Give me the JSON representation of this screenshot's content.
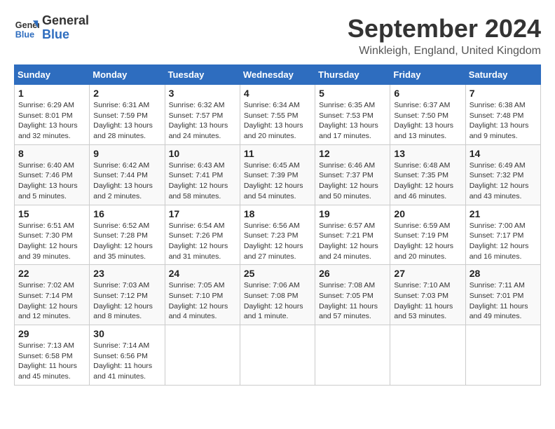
{
  "logo": {
    "line1": "General",
    "line2": "Blue"
  },
  "title": "September 2024",
  "subtitle": "Winkleigh, England, United Kingdom",
  "calendar": {
    "headers": [
      "Sunday",
      "Monday",
      "Tuesday",
      "Wednesday",
      "Thursday",
      "Friday",
      "Saturday"
    ],
    "weeks": [
      [
        {
          "day": "",
          "info": ""
        },
        {
          "day": "2",
          "info": "Sunrise: 6:31 AM\nSunset: 7:59 PM\nDaylight: 13 hours\nand 28 minutes."
        },
        {
          "day": "3",
          "info": "Sunrise: 6:32 AM\nSunset: 7:57 PM\nDaylight: 13 hours\nand 24 minutes."
        },
        {
          "day": "4",
          "info": "Sunrise: 6:34 AM\nSunset: 7:55 PM\nDaylight: 13 hours\nand 20 minutes."
        },
        {
          "day": "5",
          "info": "Sunrise: 6:35 AM\nSunset: 7:53 PM\nDaylight: 13 hours\nand 17 minutes."
        },
        {
          "day": "6",
          "info": "Sunrise: 6:37 AM\nSunset: 7:50 PM\nDaylight: 13 hours\nand 13 minutes."
        },
        {
          "day": "7",
          "info": "Sunrise: 6:38 AM\nSunset: 7:48 PM\nDaylight: 13 hours\nand 9 minutes."
        }
      ],
      [
        {
          "day": "8",
          "info": "Sunrise: 6:40 AM\nSunset: 7:46 PM\nDaylight: 13 hours\nand 5 minutes."
        },
        {
          "day": "9",
          "info": "Sunrise: 6:42 AM\nSunset: 7:44 PM\nDaylight: 13 hours\nand 2 minutes."
        },
        {
          "day": "10",
          "info": "Sunrise: 6:43 AM\nSunset: 7:41 PM\nDaylight: 12 hours\nand 58 minutes."
        },
        {
          "day": "11",
          "info": "Sunrise: 6:45 AM\nSunset: 7:39 PM\nDaylight: 12 hours\nand 54 minutes."
        },
        {
          "day": "12",
          "info": "Sunrise: 6:46 AM\nSunset: 7:37 PM\nDaylight: 12 hours\nand 50 minutes."
        },
        {
          "day": "13",
          "info": "Sunrise: 6:48 AM\nSunset: 7:35 PM\nDaylight: 12 hours\nand 46 minutes."
        },
        {
          "day": "14",
          "info": "Sunrise: 6:49 AM\nSunset: 7:32 PM\nDaylight: 12 hours\nand 43 minutes."
        }
      ],
      [
        {
          "day": "15",
          "info": "Sunrise: 6:51 AM\nSunset: 7:30 PM\nDaylight: 12 hours\nand 39 minutes."
        },
        {
          "day": "16",
          "info": "Sunrise: 6:52 AM\nSunset: 7:28 PM\nDaylight: 12 hours\nand 35 minutes."
        },
        {
          "day": "17",
          "info": "Sunrise: 6:54 AM\nSunset: 7:26 PM\nDaylight: 12 hours\nand 31 minutes."
        },
        {
          "day": "18",
          "info": "Sunrise: 6:56 AM\nSunset: 7:23 PM\nDaylight: 12 hours\nand 27 minutes."
        },
        {
          "day": "19",
          "info": "Sunrise: 6:57 AM\nSunset: 7:21 PM\nDaylight: 12 hours\nand 24 minutes."
        },
        {
          "day": "20",
          "info": "Sunrise: 6:59 AM\nSunset: 7:19 PM\nDaylight: 12 hours\nand 20 minutes."
        },
        {
          "day": "21",
          "info": "Sunrise: 7:00 AM\nSunset: 7:17 PM\nDaylight: 12 hours\nand 16 minutes."
        }
      ],
      [
        {
          "day": "22",
          "info": "Sunrise: 7:02 AM\nSunset: 7:14 PM\nDaylight: 12 hours\nand 12 minutes."
        },
        {
          "day": "23",
          "info": "Sunrise: 7:03 AM\nSunset: 7:12 PM\nDaylight: 12 hours\nand 8 minutes."
        },
        {
          "day": "24",
          "info": "Sunrise: 7:05 AM\nSunset: 7:10 PM\nDaylight: 12 hours\nand 4 minutes."
        },
        {
          "day": "25",
          "info": "Sunrise: 7:06 AM\nSunset: 7:08 PM\nDaylight: 12 hours\nand 1 minute."
        },
        {
          "day": "26",
          "info": "Sunrise: 7:08 AM\nSunset: 7:05 PM\nDaylight: 11 hours\nand 57 minutes."
        },
        {
          "day": "27",
          "info": "Sunrise: 7:10 AM\nSunset: 7:03 PM\nDaylight: 11 hours\nand 53 minutes."
        },
        {
          "day": "28",
          "info": "Sunrise: 7:11 AM\nSunset: 7:01 PM\nDaylight: 11 hours\nand 49 minutes."
        }
      ],
      [
        {
          "day": "29",
          "info": "Sunrise: 7:13 AM\nSunset: 6:58 PM\nDaylight: 11 hours\nand 45 minutes."
        },
        {
          "day": "30",
          "info": "Sunrise: 7:14 AM\nSunset: 6:56 PM\nDaylight: 11 hours\nand 41 minutes."
        },
        {
          "day": "",
          "info": ""
        },
        {
          "day": "",
          "info": ""
        },
        {
          "day": "",
          "info": ""
        },
        {
          "day": "",
          "info": ""
        },
        {
          "day": "",
          "info": ""
        }
      ]
    ],
    "week1_day1": {
      "day": "1",
      "info": "Sunrise: 6:29 AM\nSunset: 8:01 PM\nDaylight: 13 hours\nand 32 minutes."
    }
  }
}
